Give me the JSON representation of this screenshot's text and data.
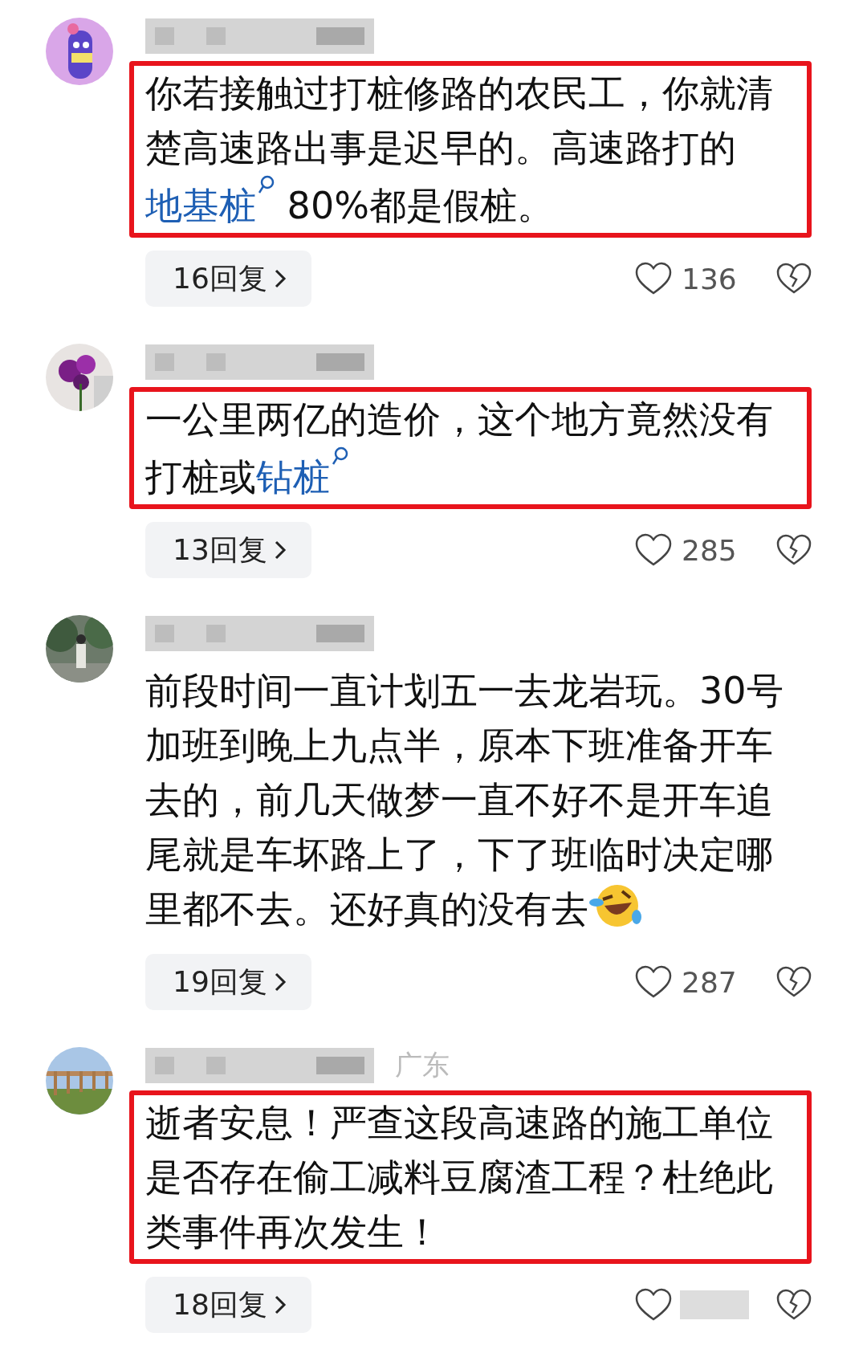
{
  "comments": [
    {
      "avatar": {
        "kind": "picture"
      },
      "highlighted": true,
      "body": [
        {
          "kind": "plain",
          "text": "你若接触过打桩修路的农民工，你就清楚高速路出事是迟早的。高速路打的"
        },
        {
          "kind": "link",
          "text": "地基桩"
        },
        {
          "kind": "plain",
          "text": " 80%都是假桩。"
        }
      ],
      "replies": "16回复",
      "likes": "136"
    },
    {
      "avatar": {
        "kind": "picture"
      },
      "highlighted": true,
      "body": [
        {
          "kind": "plain",
          "text": "一公里两亿的造价，这个地方竟然没有打桩或"
        },
        {
          "kind": "link",
          "text": "钻桩"
        }
      ],
      "replies": "13回复",
      "likes": "285"
    },
    {
      "avatar": {
        "kind": "picture"
      },
      "highlighted": false,
      "body": [
        {
          "kind": "plain",
          "text": "前段时间一直计划五一去龙岩玩。30号加班到晚上九点半，原本下班准备开车去的，前几天做梦一直不好不是开车追尾就是车坏路上了，下了班临时决定哪里都不去。还好真的没有去"
        },
        {
          "kind": "emoji"
        }
      ],
      "replies": "19回复",
      "likes": "287"
    },
    {
      "avatar": {
        "kind": "picture"
      },
      "highlighted": true,
      "location": "广东",
      "body": [
        {
          "kind": "plain",
          "text": "逝者安息！严查这段高速路的施工单位是否存在偷工减料豆腐渣工程？杜绝此类事件再次发生！"
        }
      ],
      "replies": "18回复"
    }
  ]
}
